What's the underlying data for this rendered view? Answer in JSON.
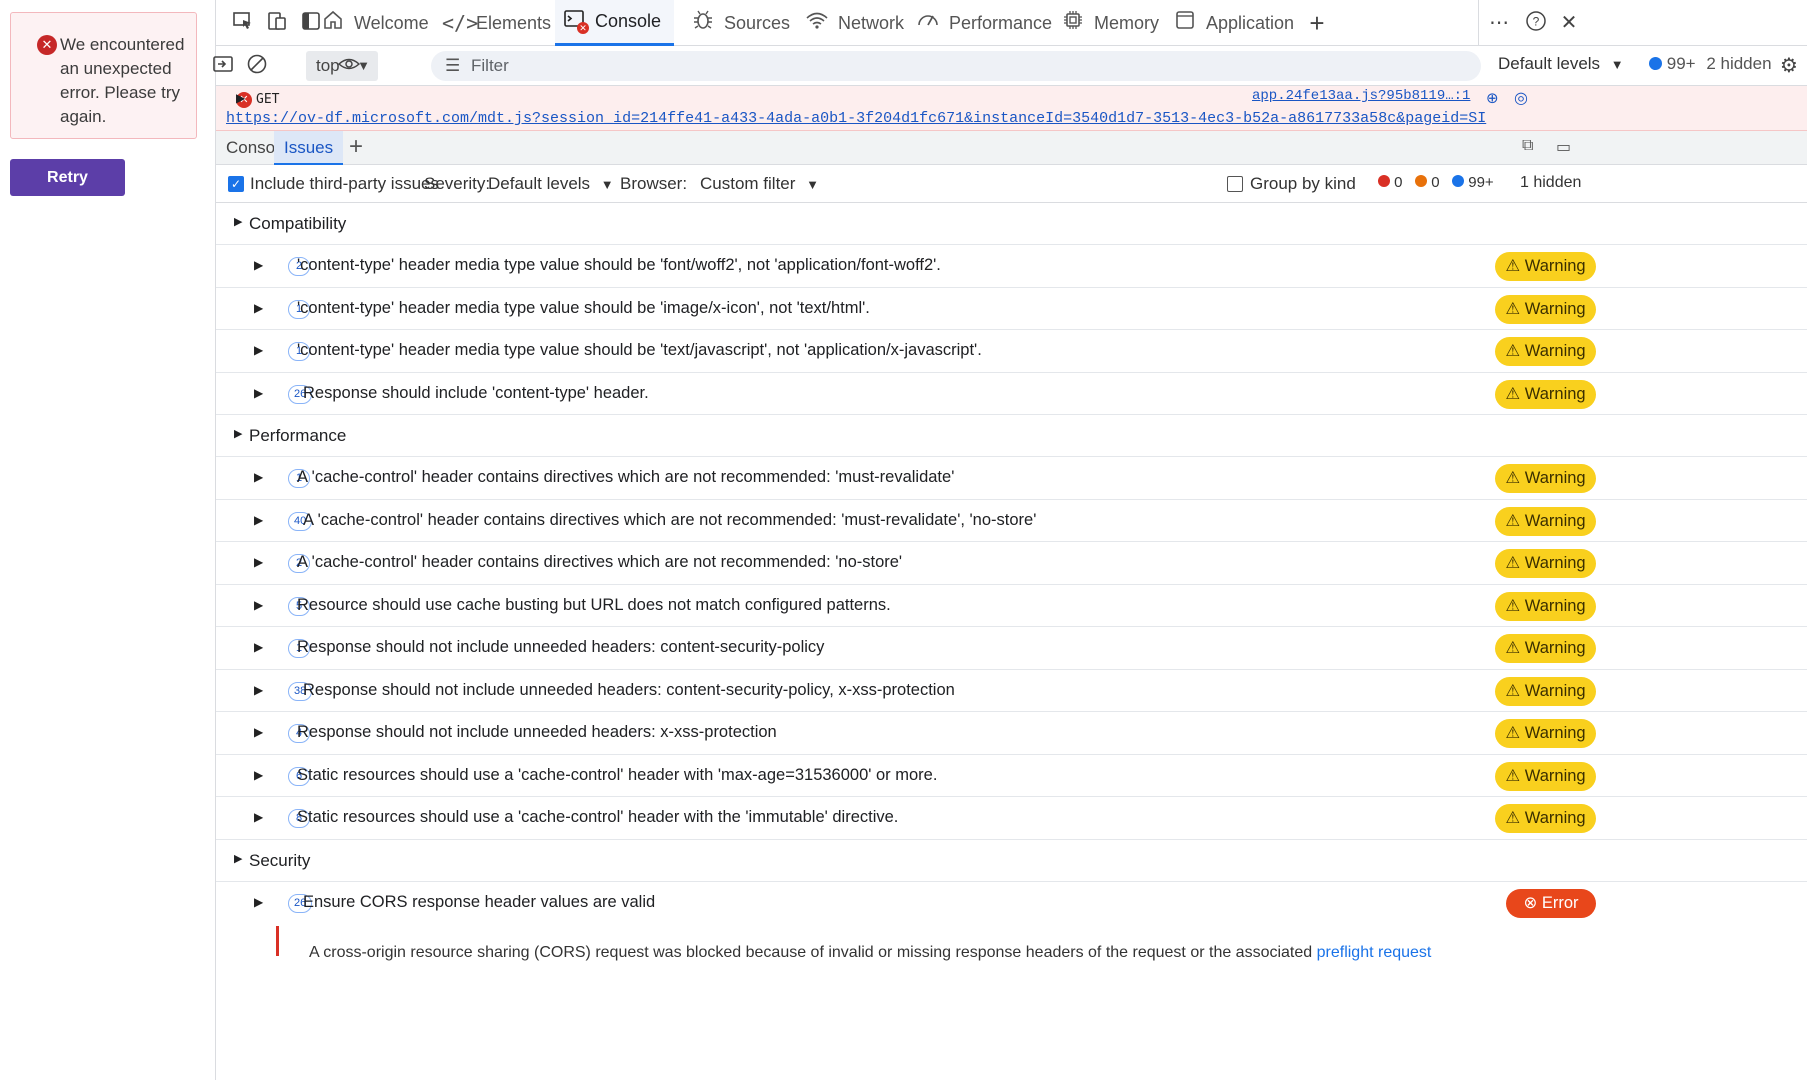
{
  "left_pane": {
    "error_message": "We encountered an unexpected error. Please try again.",
    "retry_label": "Retry"
  },
  "tabs": [
    {
      "label": "Welcome",
      "icon": "home-icon"
    },
    {
      "label": "Elements",
      "icon": "code-icon"
    },
    {
      "label": "Console",
      "icon": "console-icon",
      "active": true
    },
    {
      "label": "Sources",
      "icon": "bug-icon"
    },
    {
      "label": "Network",
      "icon": "wifi-icon"
    },
    {
      "label": "Performance",
      "icon": "gauge-icon"
    },
    {
      "label": "Memory",
      "icon": "chip-icon"
    },
    {
      "label": "Application",
      "icon": "window-icon"
    }
  ],
  "toolbar": {
    "context": "top",
    "filter_placeholder": "Filter",
    "levels": "Default levels",
    "message_count": "99+",
    "hidden": "2 hidden"
  },
  "console_error": {
    "method": "GET",
    "url": "https://ov-df.microsoft.com/mdt.js?session_id=214ffe41-a433-4ada-a0b1-3f204d1fc671&instanceId=3540d1d7-3513-4ec3-b52a-a8617733a58c&pageid=SI",
    "source": "app.24fe13aa.js?95b8119…:1"
  },
  "drawer": {
    "tabs": [
      "Console",
      "Issues"
    ],
    "active": "Issues"
  },
  "issues_bar": {
    "include_third_party": "Include third-party issues",
    "severity_label": "Severity:",
    "severity_value": "Default levels",
    "browser_label": "Browser:",
    "browser_value": "Custom filter",
    "group_by_kind": "Group by kind",
    "errors": "0",
    "warnings": "0",
    "info": "99+",
    "hidden": "1 hidden"
  },
  "categories": [
    {
      "name": "Compatibility",
      "issues": [
        {
          "count": "2",
          "title": "'content-type' header media type value should be 'font/woff2', not 'application/font-woff2'.",
          "severity": "Warning"
        },
        {
          "count": "1",
          "title": "'content-type' header media type value should be 'image/x-icon', not 'text/html'.",
          "severity": "Warning"
        },
        {
          "count": "1",
          "title": "'content-type' header media type value should be 'text/javascript', not 'application/x-javascript'.",
          "severity": "Warning"
        },
        {
          "count": "26",
          "title": "Response should include 'content-type' header.",
          "severity": "Warning"
        }
      ]
    },
    {
      "name": "Performance",
      "issues": [
        {
          "count": "1",
          "title": "A 'cache-control' header contains directives which are not recommended: 'must-revalidate'",
          "severity": "Warning"
        },
        {
          "count": "40",
          "title": "A 'cache-control' header contains directives which are not recommended: 'must-revalidate', 'no-store'",
          "severity": "Warning"
        },
        {
          "count": "2",
          "title": "A 'cache-control' header contains directives which are not recommended: 'no-store'",
          "severity": "Warning"
        },
        {
          "count": "5",
          "title": "Resource should use cache busting but URL does not match configured patterns.",
          "severity": "Warning"
        },
        {
          "count": "1",
          "title": "Response should not include unneeded headers: content-security-policy",
          "severity": "Warning"
        },
        {
          "count": "38",
          "title": "Response should not include unneeded headers: content-security-policy, x-xss-protection",
          "severity": "Warning"
        },
        {
          "count": "4",
          "title": "Response should not include unneeded headers: x-xss-protection",
          "severity": "Warning"
        },
        {
          "count": "6",
          "title": "Static resources should use a 'cache-control' header with 'max-age=31536000' or more.",
          "severity": "Warning"
        },
        {
          "count": "8",
          "title": "Static resources should use a 'cache-control' header with the 'immutable' directive.",
          "severity": "Warning"
        }
      ]
    },
    {
      "name": "Security",
      "issues": [
        {
          "count": "26",
          "title": "Ensure CORS response header values are valid",
          "severity": "Error"
        }
      ]
    }
  ],
  "cors_detail": {
    "text": "A cross-origin resource sharing (CORS) request was blocked because of invalid or missing response headers of the request or the associated ",
    "link": "preflight request"
  }
}
